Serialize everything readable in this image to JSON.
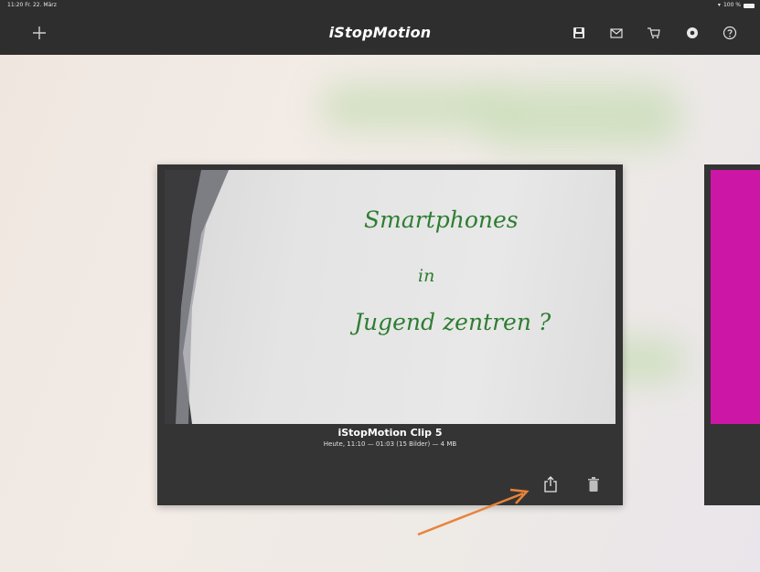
{
  "status_bar": {
    "time_date": "11:20  Fr. 22. März",
    "battery": "100 %"
  },
  "nav": {
    "title": "iStopMotion",
    "icons": [
      "plus-icon",
      "save-icon",
      "mail-icon",
      "cart-icon",
      "settings-icon",
      "help-icon"
    ]
  },
  "clips": [
    {
      "title": "iStopMotion Clip 5",
      "meta": "Heute, 11:10  —  01:03 (15 Bilder)  —  4 MB",
      "thumbnail_text": [
        "Smartphones",
        "in",
        "Jugend zentren ?"
      ]
    }
  ],
  "colors": {
    "bar": "#2e2e2e",
    "card": "#343434",
    "handwriting": "#2e7d32",
    "second_thumb": "#cc16a6",
    "annotation_arrow": "#e8833a"
  }
}
